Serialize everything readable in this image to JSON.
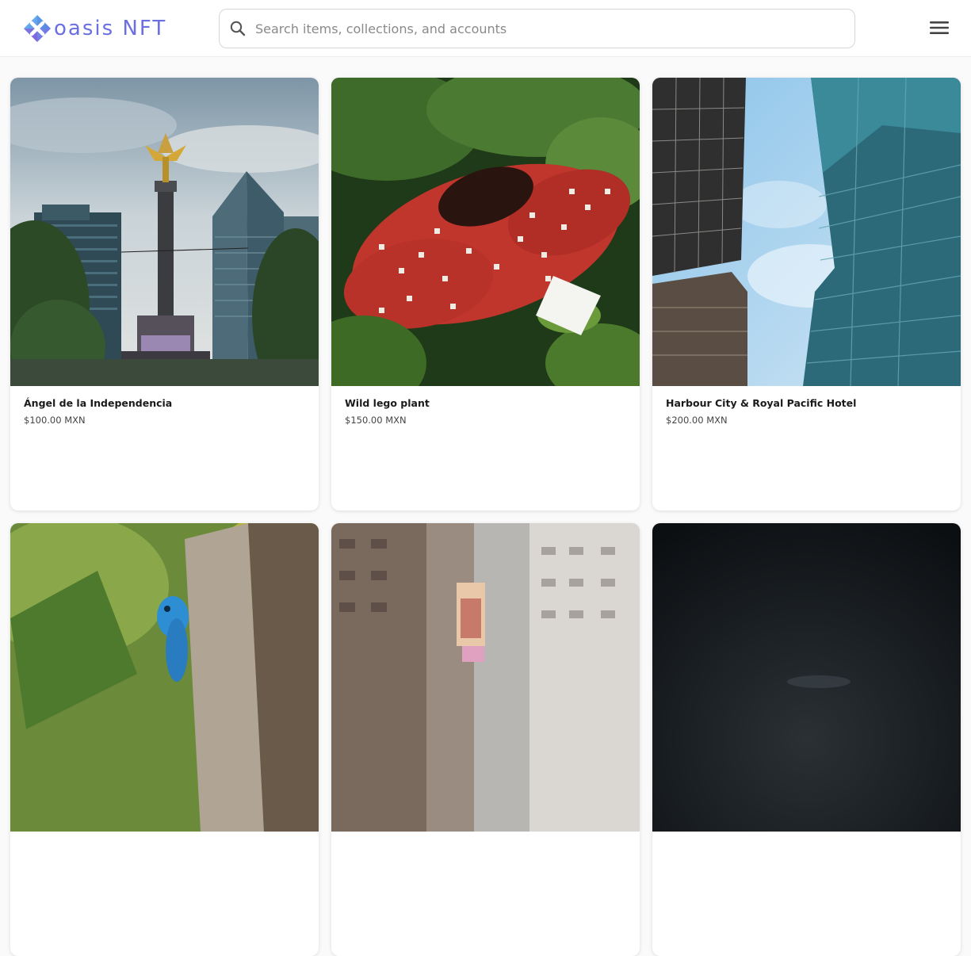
{
  "brand": {
    "name": "oasis NFT",
    "logo_icon": "oasis-x-logo",
    "accent": "#6b6fe0"
  },
  "search": {
    "placeholder": "Search items, collections, and accounts",
    "value": "",
    "icon": "search-icon"
  },
  "menu": {
    "icon": "hamburger-menu-icon"
  },
  "items": [
    {
      "title": "Ángel de la Independencia",
      "price": "$100.00 MXN",
      "image": "angel-monument-photo"
    },
    {
      "title": "Wild lego plant",
      "price": "$150.00 MXN",
      "image": "lego-flower-photo"
    },
    {
      "title": "Harbour City & Royal Pacific Hotel",
      "price": "$200.00 MXN",
      "image": "skyscrapers-photo"
    },
    {
      "title": "",
      "price": "",
      "image": "blue-lizard-photo"
    },
    {
      "title": "",
      "price": "",
      "image": "city-street-photo"
    },
    {
      "title": "",
      "price": "",
      "image": "dark-photo"
    }
  ]
}
